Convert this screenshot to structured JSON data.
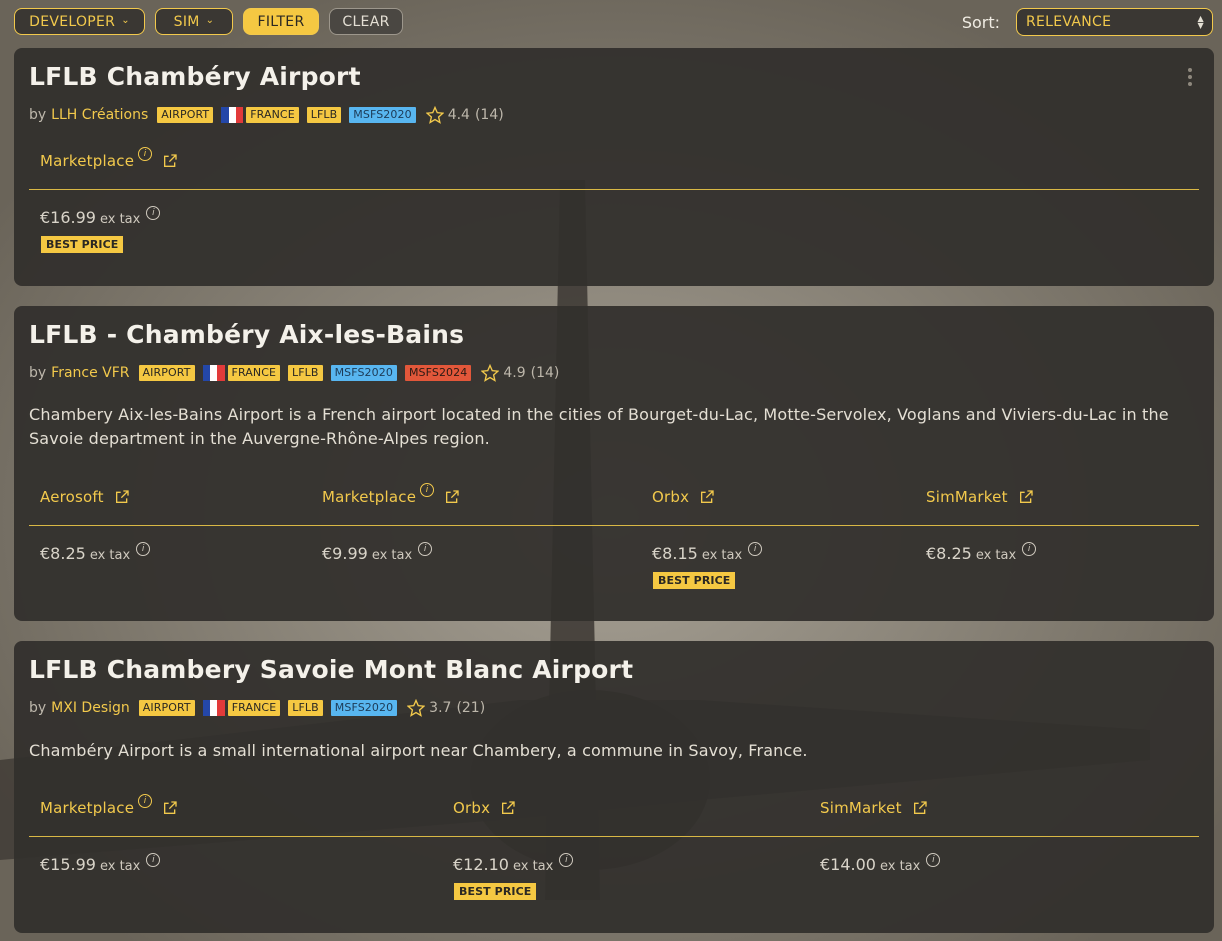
{
  "toolbar": {
    "developer_label": "DEVELOPER",
    "sim_label": "SIM",
    "filter_label": "FILTER",
    "clear_label": "CLEAR",
    "sort_label": "Sort:",
    "sort_value": "RELEVANCE"
  },
  "cards": [
    {
      "title": "LFLB Chambéry Airport",
      "by": "by",
      "developer": "LLH Créations",
      "badges": [
        "AIRPORT",
        "FRANCE",
        "LFLB",
        "MSFS2020"
      ],
      "rating": "4.4",
      "count": "(14)",
      "vendors": [
        {
          "name": "Marketplace",
          "price": "€16.99",
          "ex": "ex tax",
          "best": "BEST PRICE"
        }
      ]
    },
    {
      "title": "LFLB - Chambéry Aix-les-Bains",
      "by": "by",
      "developer": "France VFR",
      "badges": [
        "AIRPORT",
        "FRANCE",
        "LFLB",
        "MSFS2020",
        "MSFS2024"
      ],
      "rating": "4.9",
      "count": "(14)",
      "description": "Chambery Aix-les-Bains Airport is a French airport located in the cities of Bourget-du-Lac, Motte-Servolex, Voglans and Viviers-du-Lac in the Savoie department in the Auvergne-Rhône-Alpes region.",
      "vendors": [
        {
          "name": "Aerosoft",
          "price": "€8.25",
          "ex": "ex tax"
        },
        {
          "name": "Marketplace",
          "price": "€9.99",
          "ex": "ex tax"
        },
        {
          "name": "Orbx",
          "price": "€8.15",
          "ex": "ex tax",
          "best": "BEST PRICE"
        },
        {
          "name": "SimMarket",
          "price": "€8.25",
          "ex": "ex tax"
        }
      ]
    },
    {
      "title": "LFLB Chambery Savoie Mont Blanc Airport",
      "by": "by",
      "developer": "MXI Design",
      "badges": [
        "AIRPORT",
        "FRANCE",
        "LFLB",
        "MSFS2020"
      ],
      "rating": "3.7",
      "count": "(21)",
      "description": "Chambéry Airport is a small international airport near Chambery, a commune in Savoy, France.",
      "vendors": [
        {
          "name": "Marketplace",
          "price": "€15.99",
          "ex": "ex tax"
        },
        {
          "name": "Orbx",
          "price": "€12.10",
          "ex": "ex tax",
          "best": "BEST PRICE"
        },
        {
          "name": "SimMarket",
          "price": "€14.00",
          "ex": "ex tax"
        }
      ]
    }
  ],
  "colors": {
    "accent": "#f5c842",
    "card": "#32302d",
    "msfs2020": "#58b6f0",
    "msfs2024": "#e2573a"
  }
}
